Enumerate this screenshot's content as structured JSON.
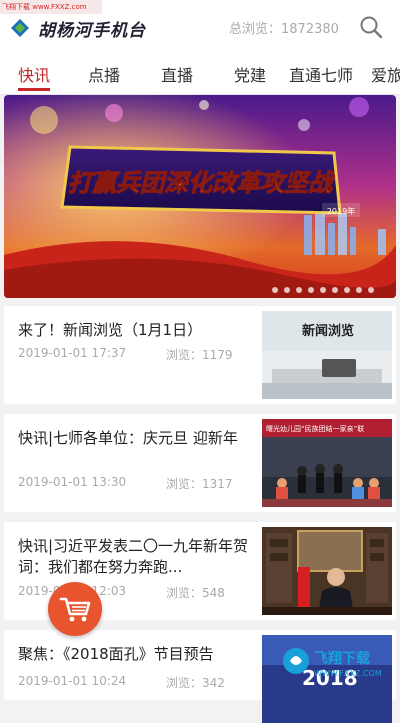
{
  "corner_watermark": "飞翔下载 www.FXXZ.com",
  "header": {
    "logo_text": "胡杨河手机台",
    "views": "总浏览：1872380",
    "search_icon": "search-icon"
  },
  "tabs": [
    {
      "label": "快讯",
      "active": true
    },
    {
      "label": "点播"
    },
    {
      "label": "直播"
    },
    {
      "label": "党建"
    },
    {
      "label": "直通七师"
    },
    {
      "label": "爱旅"
    }
  ],
  "banner": {
    "headline": "打赢兵团深化改革攻坚战",
    "badge": "2019年",
    "slide_count": 9,
    "active_slide": 1
  },
  "news": [
    {
      "title": "来了！新闻浏览（1月1日）",
      "date": "2019-01-01 17:37",
      "views": "浏览：1179",
      "thumb": "news-studio",
      "thumb_text": "新闻浏览"
    },
    {
      "title": "快讯|七师各单位：庆元旦 迎新年",
      "date": "2019-01-01 13:30",
      "views": "浏览：1317",
      "thumb": "kindergarten-stage",
      "thumb_text": "曙光幼儿园“民族团结一家亲”联"
    },
    {
      "title": "快讯|习近平发表二〇一九年新年贺词：我们都在努力奔跑...",
      "date": "2019-01-01 12:03",
      "views": "浏览：548",
      "thumb": "speech-office",
      "thumb_text": ""
    },
    {
      "title": "聚焦：《2018面孔》节目预告",
      "date": "2019-01-01 10:24",
      "views": "浏览：342",
      "thumb": "program-preview",
      "thumb_text": "2018"
    }
  ],
  "floating_cart_icon": "shopping-cart-icon",
  "bottom_watermark": {
    "brand": "飞翔下载",
    "url": "WWW.FXXZ.COM"
  }
}
